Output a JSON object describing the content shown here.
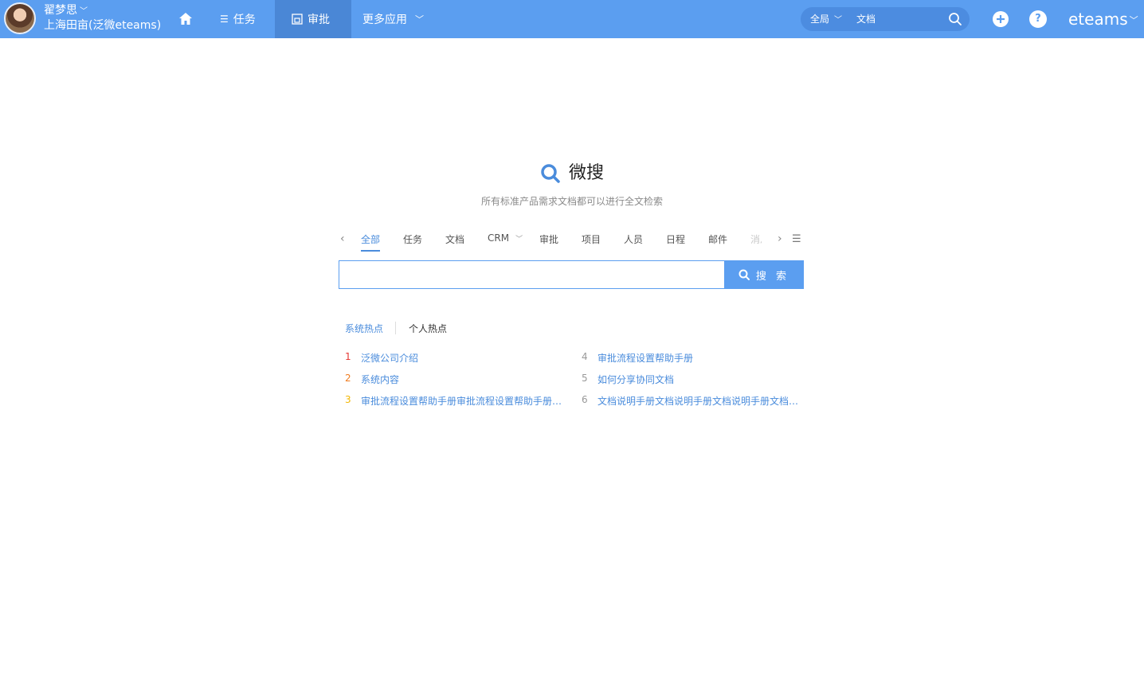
{
  "header": {
    "user_name": "翟梦思",
    "user_org": "上海田亩(泛微eteams)",
    "nav": {
      "task": "任务",
      "approve": "审批",
      "more": "更多应用"
    },
    "search": {
      "scope": "全局",
      "text": "文档"
    },
    "brand": "eteams"
  },
  "main": {
    "title": "微搜",
    "subtitle": "所有标准产品需求文档都可以进行全文检索",
    "tabs": [
      "全部",
      "任务",
      "文档",
      "CRM",
      "审批",
      "项目",
      "人员",
      "日程",
      "邮件",
      "消息"
    ],
    "search_button": "搜 索",
    "hot_tabs": [
      "系统热点",
      "个人热点"
    ],
    "hot_items": [
      {
        "rank": "1",
        "text": "泛微公司介绍"
      },
      {
        "rank": "2",
        "text": "系统内容"
      },
      {
        "rank": "3",
        "text": "审批流程设置帮助手册审批流程设置帮助手册审批流程设置帮助手册"
      },
      {
        "rank": "4",
        "text": "审批流程设置帮助手册"
      },
      {
        "rank": "5",
        "text": "如何分享协同文档"
      },
      {
        "rank": "6",
        "text": "文档说明手册文档说明手册文档说明手册文档说明手册"
      }
    ]
  },
  "colors": {
    "topbar": "#5b9ef0",
    "nav_active": "#4a87d6",
    "accent": "#4a8cdc",
    "rank1": "#e53935",
    "rank2": "#f07c1f",
    "rank3": "#f2b705",
    "rank_other": "#999999"
  },
  "icons": [
    "home-icon",
    "list-icon",
    "approve-icon",
    "chevron-down-icon",
    "search-icon",
    "plus-circle-icon",
    "help-icon",
    "menu-icon"
  ]
}
